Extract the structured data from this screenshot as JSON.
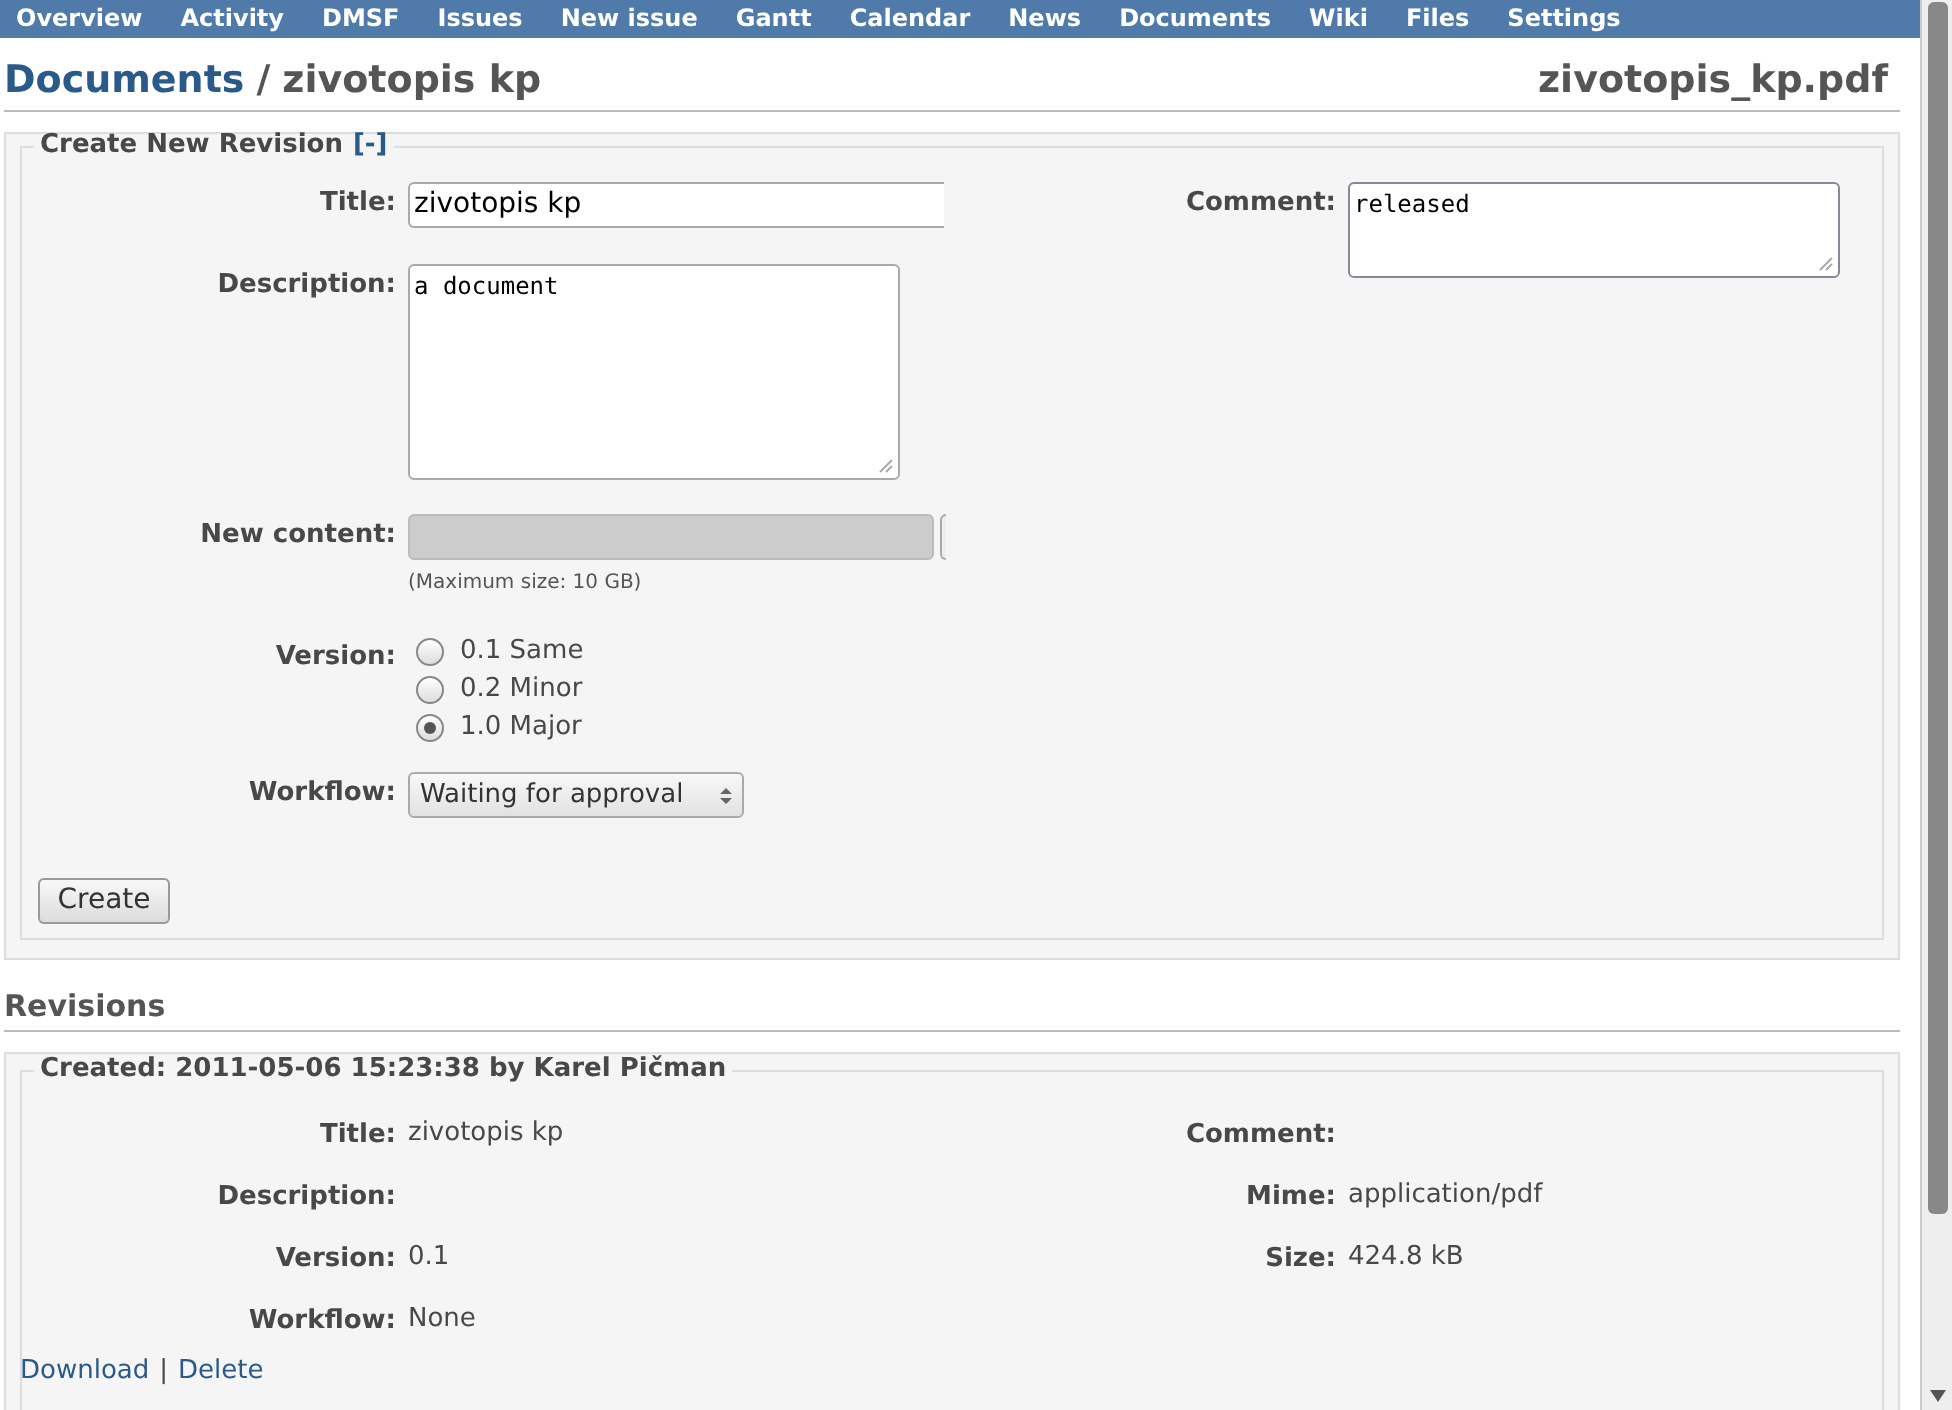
{
  "menu": [
    "Overview",
    "Activity",
    "DMSF",
    "Issues",
    "New issue",
    "Gantt",
    "Calendar",
    "News",
    "Documents",
    "Wiki",
    "Files",
    "Settings"
  ],
  "header": {
    "section_link": "Documents",
    "separator": "/",
    "title": "zivotopis kp",
    "filename": "zivotopis_kp.pdf"
  },
  "form": {
    "legend": "Create New Revision",
    "toggle": "[-]",
    "title": {
      "label": "Title:",
      "value": "zivotopis kp"
    },
    "description": {
      "label": "Description:",
      "value": "a document"
    },
    "comment": {
      "label": "Comment:",
      "value": "released"
    },
    "new_content": {
      "label": "New content:",
      "hint": "(Maximum size: 10 GB)"
    },
    "version": {
      "label": "Version:",
      "options": [
        {
          "label": "0.1 Same",
          "selected": false
        },
        {
          "label": "0.2 Minor",
          "selected": false
        },
        {
          "label": "1.0 Major",
          "selected": true
        }
      ]
    },
    "workflow": {
      "label": "Workflow:",
      "value": "Waiting for approval"
    },
    "submit": "Create"
  },
  "revisions": {
    "heading": "Revisions",
    "items": [
      {
        "created": "Created: 2011-05-06 15:23:38 by Karel Pičman",
        "left": [
          {
            "label": "Title:",
            "value": "zivotopis kp"
          },
          {
            "label": "Description:"
          },
          {
            "label": "Version:",
            "value": "0.1"
          },
          {
            "label": "Workflow:",
            "value": "None"
          }
        ],
        "right": [
          {
            "label": "Comment:"
          },
          {
            "label": "Mime:",
            "value": "application/pdf"
          },
          {
            "label": "Size:",
            "value": "424.8 kB"
          }
        ],
        "actions": [
          "Download",
          "Delete"
        ],
        "action_separator": "|"
      }
    ]
  }
}
